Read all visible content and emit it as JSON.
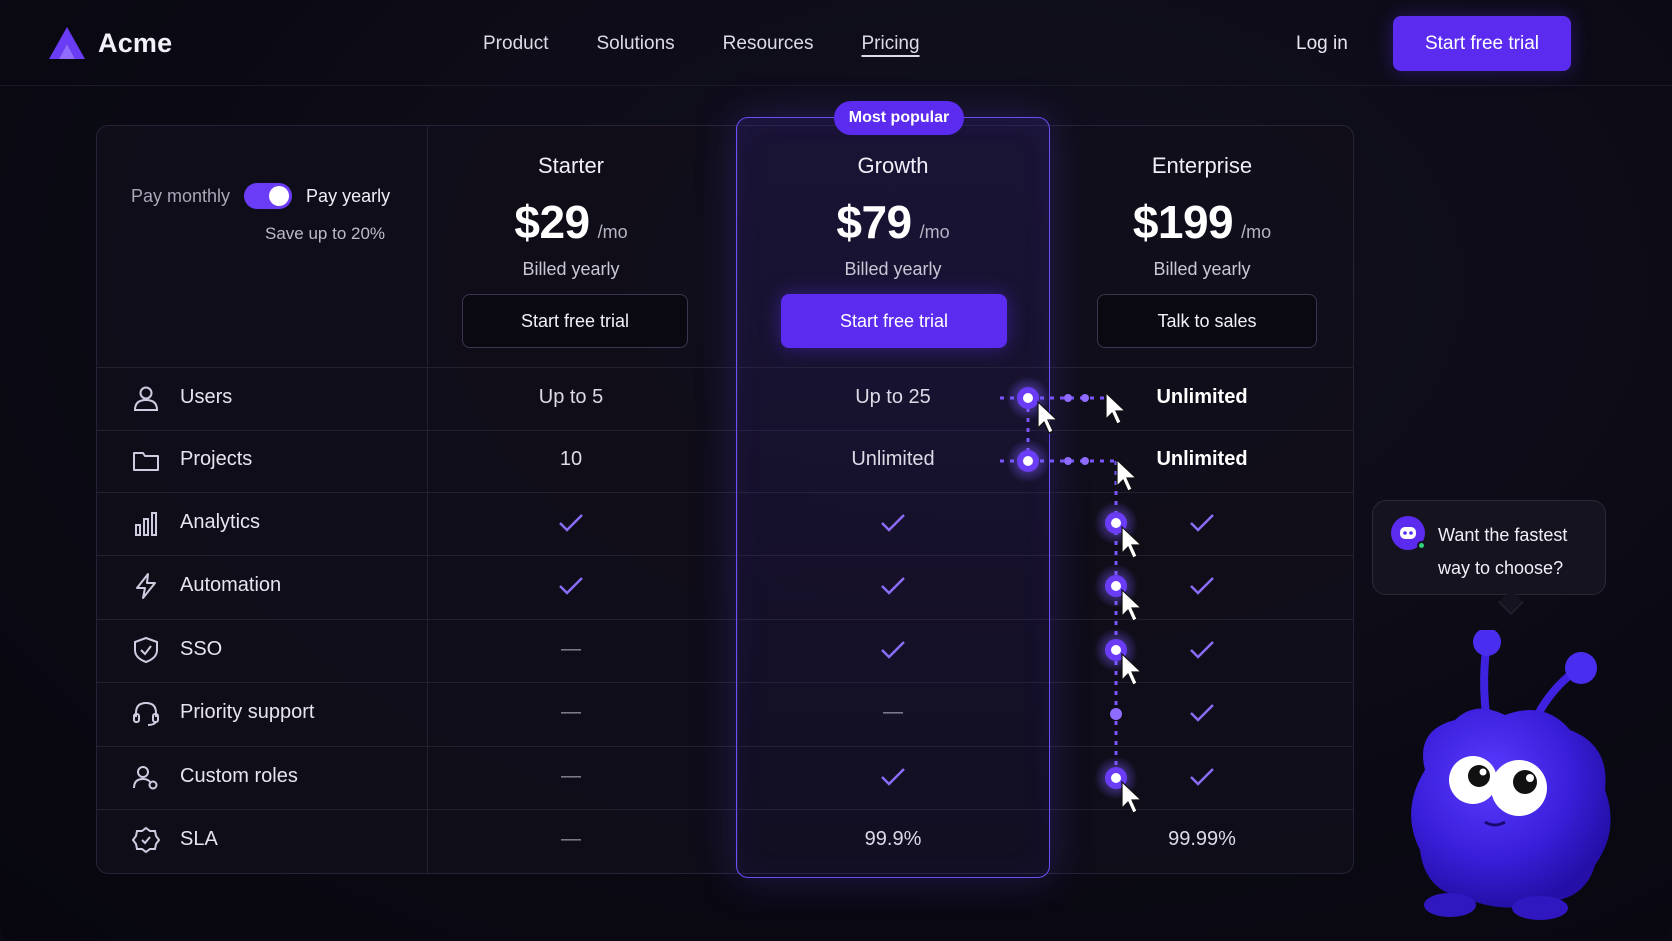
{
  "nav": {
    "brand": "Acme",
    "links": [
      "Product",
      "Solutions",
      "Resources",
      "Pricing"
    ],
    "active_link": "Pricing",
    "login": "Log in",
    "cta": "Start free trial"
  },
  "billing": {
    "monthly_label": "Pay monthly",
    "yearly_label": "Pay yearly",
    "yearly_selected": true,
    "save_note": "Save up to 20%"
  },
  "plans": [
    {
      "name": "Starter",
      "price": "$29",
      "period": "/mo",
      "billed": "Billed yearly",
      "button": "Start free trial"
    },
    {
      "name": "Growth",
      "price": "$79",
      "period": "/mo",
      "billed": "Billed yearly",
      "button": "Start free trial",
      "badge": "Most popular"
    },
    {
      "name": "Enterprise",
      "price": "$199",
      "period": "/mo",
      "billed": "Billed yearly",
      "button": "Talk to sales"
    }
  ],
  "features": [
    {
      "name": "Users",
      "icon": "user-icon",
      "values": [
        "Up to 5",
        "Up to 25",
        "Unlimited"
      ]
    },
    {
      "name": "Projects",
      "icon": "folder-icon",
      "values": [
        "10",
        "Unlimited",
        "Unlimited"
      ]
    },
    {
      "name": "Analytics",
      "icon": "bar-chart-icon",
      "values": [
        "check",
        "check",
        "check"
      ]
    },
    {
      "name": "Automation",
      "icon": "lightning-icon",
      "values": [
        "check",
        "check",
        "check"
      ]
    },
    {
      "name": "SSO",
      "icon": "shield-check-icon",
      "values": [
        "dash",
        "check",
        "check"
      ]
    },
    {
      "name": "Priority support",
      "icon": "headset-icon",
      "values": [
        "dash",
        "dash",
        "check"
      ]
    },
    {
      "name": "Custom roles",
      "icon": "users-gear-icon",
      "values": [
        "dash",
        "check",
        "check"
      ]
    },
    {
      "name": "SLA",
      "icon": "badge-check-icon",
      "values": [
        "dash",
        "99.9%",
        "99.99%"
      ]
    }
  ],
  "symbols": {
    "check": "✓",
    "dash": "—"
  },
  "chat": {
    "message": "Want the fastest way to choose?"
  },
  "colors": {
    "accent": "#5b2cf0",
    "check": "#8b6cf7",
    "online": "#2fd27a"
  }
}
